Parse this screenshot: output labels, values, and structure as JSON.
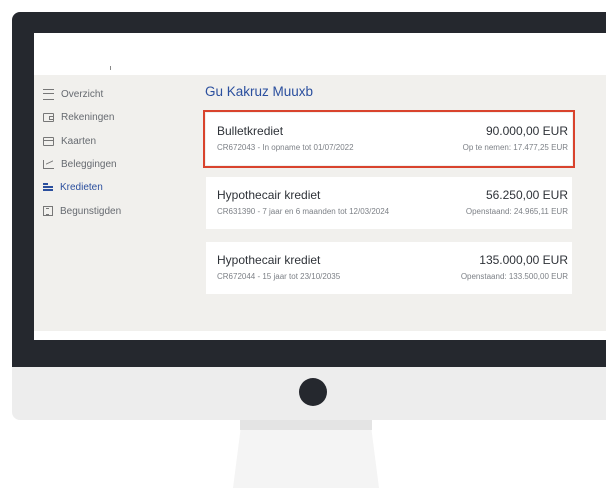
{
  "sidebar": {
    "items": [
      {
        "label": "Overzicht",
        "icon": "list-icon",
        "active": false
      },
      {
        "label": "Rekeningen",
        "icon": "wallet-icon",
        "active": false
      },
      {
        "label": "Kaarten",
        "icon": "card-icon",
        "active": false
      },
      {
        "label": "Beleggingen",
        "icon": "chart-icon",
        "active": false
      },
      {
        "label": "Kredieten",
        "icon": "coins-icon",
        "active": true
      },
      {
        "label": "Begunstigden",
        "icon": "address-book-icon",
        "active": false
      }
    ]
  },
  "main": {
    "title": "Gu Kakruz Muuxb",
    "loans": [
      {
        "name": "Bulletkrediet",
        "subtitle": "CR672043 - In opname tot 01/07/2022",
        "amount": "90.000,00 EUR",
        "extra": "Op te nemen: 17.477,25 EUR",
        "highlighted": true
      },
      {
        "name": "Hypothecair krediet",
        "subtitle": "CR631390 - 7 jaar en 6 maanden tot 12/03/2024",
        "amount": "56.250,00 EUR",
        "extra": "Openstaand: 24.965,11 EUR",
        "highlighted": false
      },
      {
        "name": "Hypothecair krediet",
        "subtitle": "CR672044 - 15 jaar tot 23/10/2035",
        "amount": "135.000,00 EUR",
        "extra": "Openstaand: 133.500,00 EUR",
        "highlighted": false
      }
    ]
  },
  "colors": {
    "accent": "#2b4f9e",
    "highlight": "#d9432d",
    "bezel": "#25282e",
    "app_background": "#f1f0ed"
  }
}
